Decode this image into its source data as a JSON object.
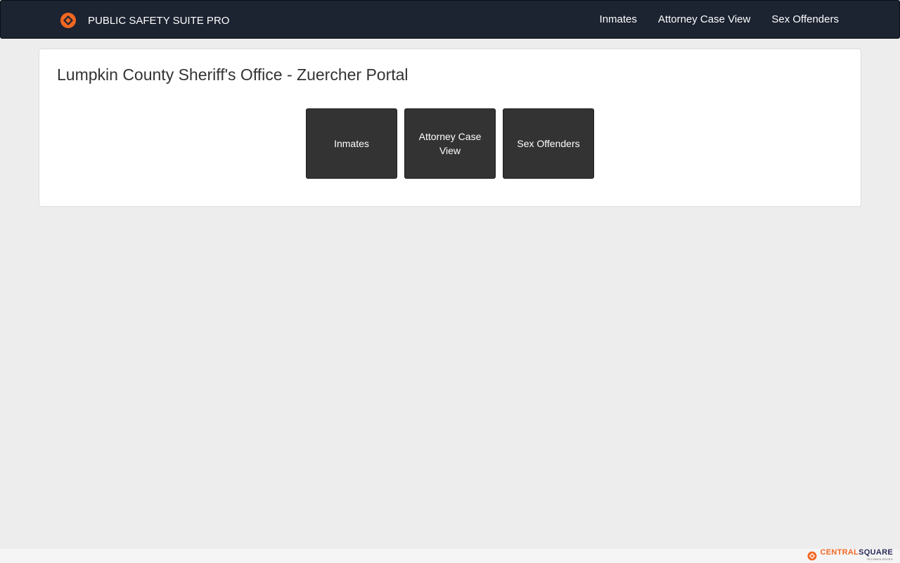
{
  "navbar": {
    "brand_text": "PUBLIC SAFETY SUITE PRO",
    "logo_icon": "centralsquare-diamond-icon",
    "links": [
      {
        "label": "Inmates"
      },
      {
        "label": "Attorney Case View"
      },
      {
        "label": "Sex Offenders"
      }
    ]
  },
  "main": {
    "title": "Lumpkin County Sheriff's Office - Zuercher Portal",
    "tiles": [
      {
        "label": "Inmates"
      },
      {
        "label": "Attorney Case View"
      },
      {
        "label": "Sex Offenders"
      }
    ]
  },
  "footer": {
    "brand_orange": "CENTRAL",
    "brand_dark": "SQUARE",
    "brand_sub": "TECHNOLOGIES"
  },
  "colors": {
    "navbar_bg": "#1c2331",
    "accent_orange": "#f26722",
    "tile_bg": "#333333",
    "page_bg": "#ededed"
  }
}
